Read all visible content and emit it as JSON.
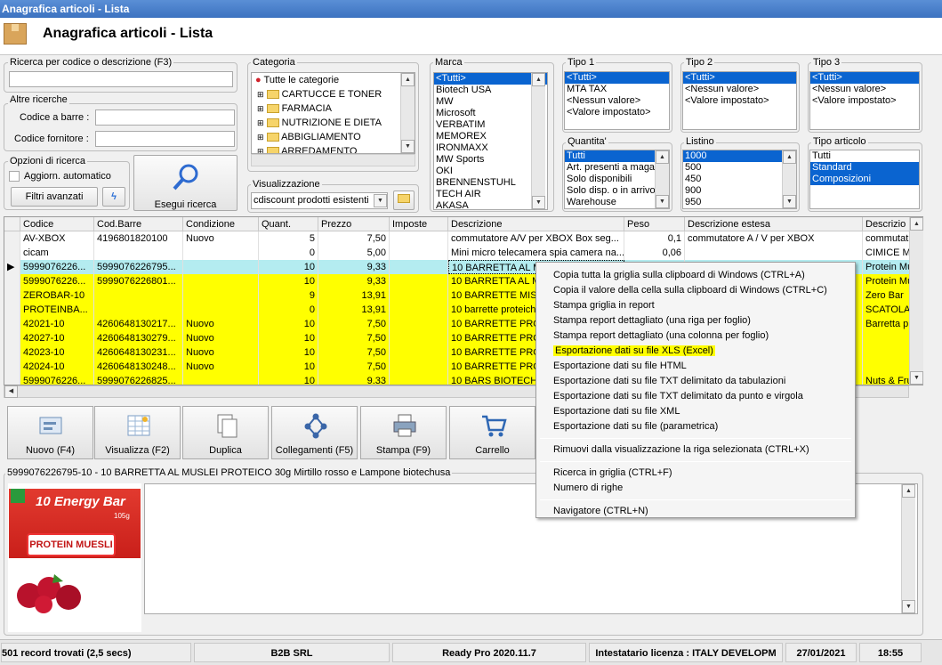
{
  "window": {
    "title": "Anagrafica articoli  - Lista",
    "header": "Anagrafica articoli  - Lista"
  },
  "search": {
    "label": "Ricerca per codice o descrizione (F3)",
    "value": ""
  },
  "other": {
    "label": "Altre ricerche",
    "barcode_label": "Codice a barre :",
    "supplier_label": "Codice fornitore :"
  },
  "options": {
    "label": "Opzioni di ricerca",
    "auto": "Aggiorn. automatico",
    "advanced": "Filtri avanzati",
    "execute": "Esegui ricerca"
  },
  "categoria": {
    "label": "Categoria",
    "items": [
      "Tutte le categorie",
      "CARTUCCE E TONER",
      "FARMACIA",
      "NUTRIZIONE E DIETA",
      "ABBIGLIAMENTO",
      "ARREDAMENTO"
    ]
  },
  "visual": {
    "label": "Visualizzazione",
    "value": "cdiscount prodotti esistenti"
  },
  "marca": {
    "label": "Marca",
    "items": [
      "<Tutti>",
      "Biotech USA",
      "MW",
      "Microsoft",
      "VERBATIM",
      "MEMOREX",
      "IRONMAXX",
      "MW Sports",
      "OKI",
      "BRENNENSTUHL",
      "TECH AIR",
      "AKASA"
    ]
  },
  "tipo1": {
    "label": "Tipo 1",
    "items": [
      "<Tutti>",
      "MTA TAX",
      "<Nessun valore>",
      "<Valore impostato>"
    ]
  },
  "tipo2": {
    "label": "Tipo 2",
    "items": [
      "<Tutti>",
      "<Nessun valore>",
      "<Valore impostato>"
    ]
  },
  "tipo3": {
    "label": "Tipo 3",
    "items": [
      "<Tutti>",
      "<Nessun valore>",
      "<Valore impostato>"
    ]
  },
  "quantita": {
    "label": "Quantita'",
    "items": [
      "Tutti",
      "Art. presenti a maga",
      "Solo disponibili",
      "Solo disp. o in arrivo",
      "Warehouse"
    ]
  },
  "listino": {
    "label": "Listino",
    "items": [
      "1000",
      "500",
      "450",
      "900",
      "950"
    ]
  },
  "tipoart": {
    "label": "Tipo articolo",
    "items": [
      "Tutti",
      "Standard",
      "Composizioni"
    ]
  },
  "grid": {
    "headers": [
      "Codice",
      "Cod.Barre",
      "Condizione",
      "Quant.",
      "Prezzo",
      "Imposte",
      "Descrizione",
      "Peso",
      "Descrizione estesa",
      "Descrizio"
    ],
    "rows": [
      [
        "AV-XBOX",
        "4196801820100",
        "Nuovo",
        "5",
        "7,50",
        "",
        "commutatore A/V per XBOX  Box seg...",
        "0,1",
        "commutatore A / V per XBOX",
        "commutat"
      ],
      [
        "cicam",
        "",
        "",
        "0",
        "5,00",
        "",
        "Mini micro telecamera spia camera na...",
        "0,06",
        "",
        "CIMICE M"
      ],
      [
        "5999076226...",
        "5999076226795...",
        "",
        "10",
        "9,33",
        "",
        "10 BARRETTA AL MU",
        "",
        "",
        "Protein Mu"
      ],
      [
        "5999076226...",
        "5999076226801...",
        "",
        "10",
        "9,33",
        "",
        "10 BARRETTA AL MU",
        "",
        "",
        "Protein Mu"
      ],
      [
        "ZEROBAR-10",
        "",
        "",
        "9",
        "13,91",
        "",
        "10 BARRETTE MISTE",
        "",
        "",
        "Zero Bar"
      ],
      [
        "PROTEINBA...",
        "",
        "",
        "0",
        "13,91",
        "",
        "10 barrette proteich",
        "",
        "",
        "SCATOLA"
      ],
      [
        "42021-10",
        "4260648130217...",
        "Nuovo",
        "10",
        "7,50",
        "",
        "10 BARRETTE PROT",
        "",
        "",
        "Barretta p"
      ],
      [
        "42027-10",
        "4260648130279...",
        "Nuovo",
        "10",
        "7,50",
        "",
        "10 BARRETTE PROT",
        "",
        "",
        ""
      ],
      [
        "42023-10",
        "4260648130231...",
        "Nuovo",
        "10",
        "7,50",
        "",
        "10 BARRETTE PROT",
        "",
        "",
        ""
      ],
      [
        "42024-10",
        "4260648130248...",
        "Nuovo",
        "10",
        "7,50",
        "",
        "10 BARRETTE PROT",
        "",
        "",
        ""
      ],
      [
        "5999076226...",
        "5999076226825...",
        "",
        "10",
        "9.33",
        "",
        "10 BARS BIOTECH U",
        "",
        "",
        "Nuts & Fru"
      ]
    ]
  },
  "toolbar": [
    "Nuovo (F4)",
    "Visualizza (F2)",
    "Duplica",
    "Collegamenti (F5)",
    "Stampa (F9)",
    "Carrello"
  ],
  "detail": {
    "caption": "5999076226795-10 - 10 BARRETTA AL MUSLEI PROTEICO  30g Mirtillo rosso e Lampone   biotechusa",
    "product_title": "10 Energy Bar",
    "product_weight": "105g",
    "product_label": "PROTEIN MUESLI"
  },
  "menu": [
    "Copia tutta la griglia sulla clipboard di Windows (CTRL+A)",
    "Copia il valore della cella sulla clipboard di Windows (CTRL+C)",
    "Stampa griglia in report",
    "Stampa report dettagliato (una riga per foglio)",
    "Stampa report dettagliato (una colonna per foglio)",
    "Esportazione dati su file XLS (Excel)",
    "Esportazione dati su file HTML",
    "Esportazione dati su file TXT delimitato da tabulazioni",
    "Esportazione dati su file TXT delimitato da punto e virgola",
    "Esportazione dati su file XML",
    "Esportazione dati su file (parametrica)",
    "Rimuovi dalla visualizzazione la riga selezionata (CTRL+X)",
    "Ricerca in griglia (CTRL+F)",
    "Numero di righe",
    "Navigatore (CTRL+N)"
  ],
  "status": {
    "records": "501 record trovati (2,5 secs)",
    "company": "B2B SRL",
    "version": "Ready Pro 2020.11.7",
    "license": "Intestatario licenza : ITALY DEVELOPM",
    "date": "27/01/2021",
    "time": "18:55"
  },
  "colors": {
    "highlight_row": "#ffff00",
    "selected_row": "#b4ecf0",
    "menu_highlight": "#ffff00",
    "title_blue": "#3c72c0"
  }
}
